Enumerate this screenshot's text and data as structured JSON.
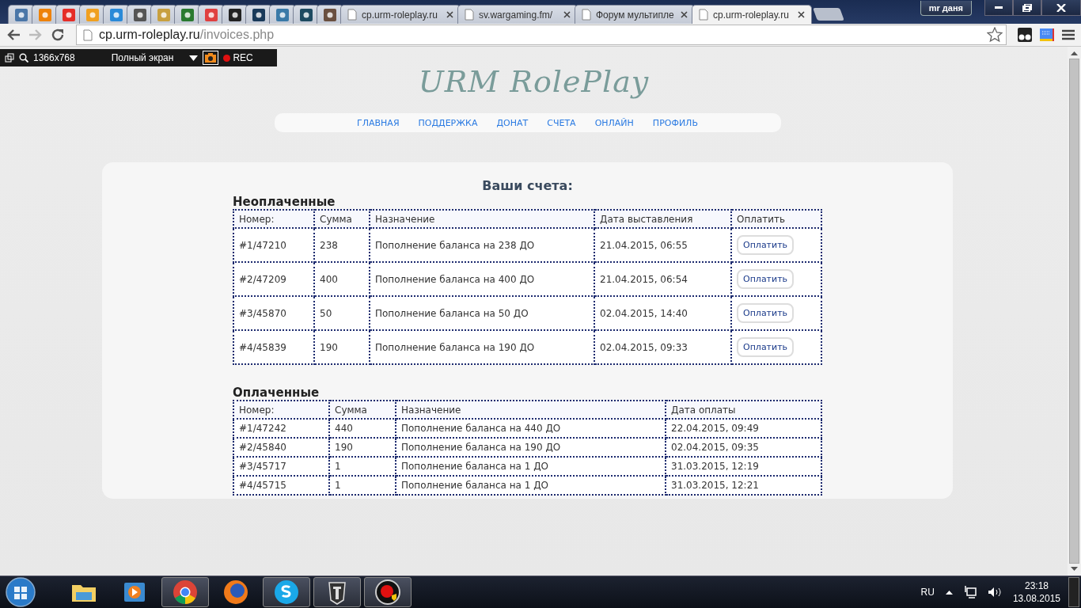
{
  "browser": {
    "tabs": [
      {
        "kind": "icon",
        "color": "#4a76a8",
        "selected": false
      },
      {
        "kind": "icon",
        "color": "#ee8208",
        "selected": false
      },
      {
        "kind": "icon",
        "color": "#e52d27",
        "selected": false
      },
      {
        "kind": "icon",
        "color": "#f0a020",
        "selected": false
      },
      {
        "kind": "icon",
        "color": "#2a8ad8",
        "selected": false
      },
      {
        "kind": "icon",
        "color": "#555555",
        "selected": false
      },
      {
        "kind": "icon",
        "color": "#c8a040",
        "selected": false
      },
      {
        "kind": "icon",
        "color": "#2a7a30",
        "selected": false
      },
      {
        "kind": "icon",
        "color": "#e04040",
        "selected": false
      },
      {
        "kind": "icon",
        "color": "#222222",
        "selected": false
      },
      {
        "kind": "icon",
        "color": "#1a3a5a",
        "selected": false
      },
      {
        "kind": "icon",
        "color": "#3a7aa8",
        "selected": false
      },
      {
        "kind": "icon",
        "color": "#1d4a60",
        "selected": false
      },
      {
        "kind": "icon",
        "color": "#6a5040",
        "selected": false
      },
      {
        "kind": "page",
        "title": "cp.urm-roleplay.ru",
        "selected": false
      },
      {
        "kind": "page",
        "title": "sv.wargaming.fm/",
        "selected": false
      },
      {
        "kind": "page",
        "title": "Форум мультипле",
        "selected": false
      },
      {
        "kind": "page",
        "title": "cp.urm-roleplay.ru",
        "selected": true
      }
    ],
    "profile": "mr даня",
    "address": {
      "host": "cp.urm-roleplay.ru",
      "path": "/invoices.php"
    }
  },
  "recorder": {
    "size": "1366x768",
    "mode": "Полный экран",
    "rec": "REC"
  },
  "site": {
    "logo": "URM RolePlay",
    "nav": [
      "ГЛАВНАЯ",
      "ПОДДЕРЖКА",
      "ДОНАТ",
      "СЧЕТА",
      "ОНЛАЙН",
      "ПРОФИЛЬ"
    ],
    "heading": "Ваши счета:",
    "unpaid": {
      "title": "Неоплаченные",
      "columns": [
        "Номер:",
        "Сумма",
        "Назначение",
        "Дата выставления",
        "Оплатить"
      ],
      "rows": [
        {
          "cells": [
            "#1/47210",
            "238",
            "Пополнение баланса на 238 ДО",
            "21.04.2015, 06:55"
          ],
          "button": "Оплатить"
        },
        {
          "cells": [
            "#2/47209",
            "400",
            "Пополнение баланса на 400 ДО",
            "21.04.2015, 06:54"
          ],
          "button": "Оплатить"
        },
        {
          "cells": [
            "#3/45870",
            "50",
            "Пополнение баланса на 50 ДО",
            "02.04.2015, 14:40"
          ],
          "button": "Оплатить"
        },
        {
          "cells": [
            "#4/45839",
            "190",
            "Пополнение баланса на 190 ДО",
            "02.04.2015, 09:33"
          ],
          "button": "Оплатить"
        }
      ]
    },
    "paid": {
      "title": "Оплаченные",
      "columns": [
        "Номер:",
        "Сумма",
        "Назначение",
        "Дата оплаты"
      ],
      "rows": [
        [
          "#1/47242",
          "440",
          "Пополнение баланса на 440 ДО",
          "22.04.2015, 09:49"
        ],
        [
          "#2/45840",
          "190",
          "Пополнение баланса на 190 ДО",
          "02.04.2015, 09:35"
        ],
        [
          "#3/45717",
          "1",
          "Пополнение баланса на 1 ДО",
          "31.03.2015, 12:19"
        ],
        [
          "#4/45715",
          "1",
          "Пополнение баланса на 1 ДО",
          "31.03.2015, 12:21"
        ]
      ]
    }
  },
  "taskbar": {
    "apps": [
      {
        "kind": "folder",
        "active": false
      },
      {
        "kind": "player",
        "active": false
      },
      {
        "kind": "chrome",
        "active": true
      },
      {
        "kind": "firefox",
        "active": false
      },
      {
        "kind": "skype",
        "active": true
      },
      {
        "kind": "tank",
        "active": true
      },
      {
        "kind": "recorder",
        "active": true
      }
    ],
    "language": "RU",
    "time": "23:18",
    "date": "13.08.2015"
  }
}
